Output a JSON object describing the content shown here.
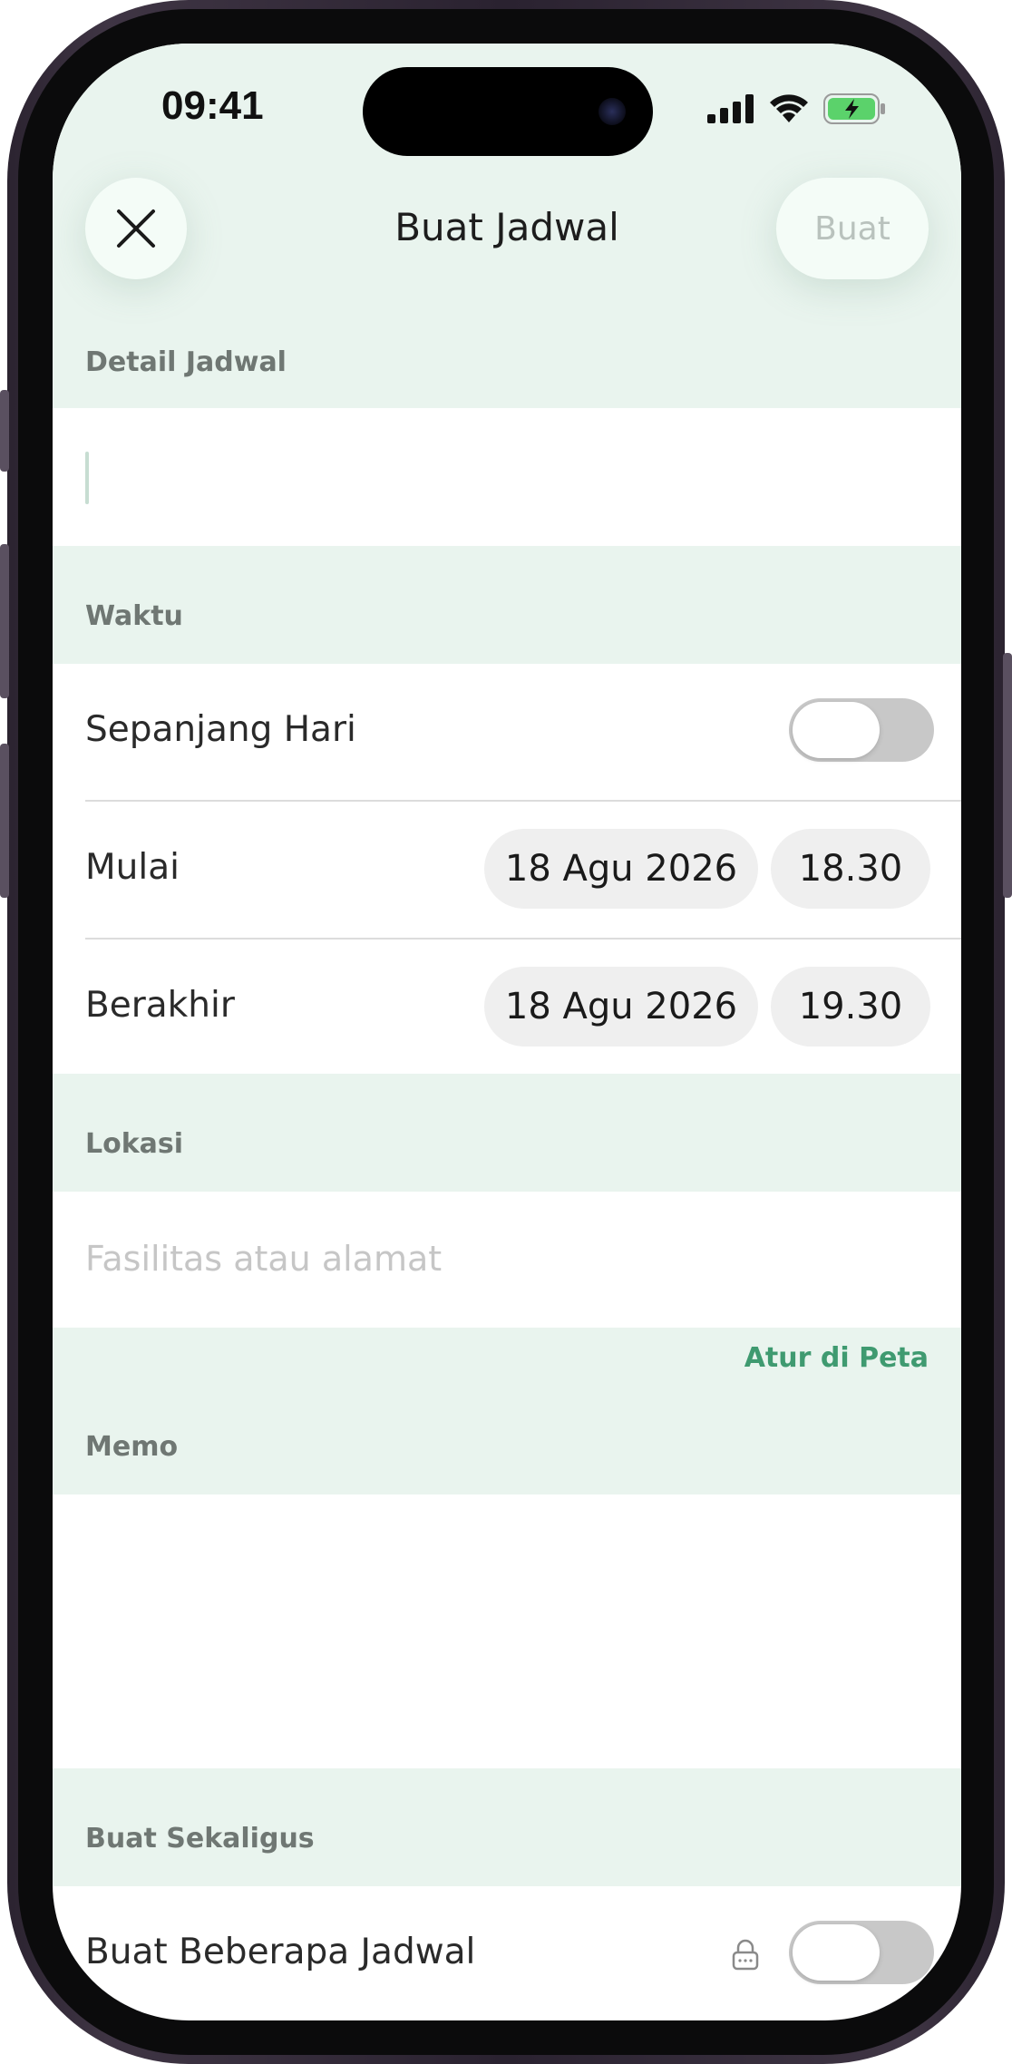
{
  "status_bar": {
    "time": "09:41",
    "icons": [
      "signal-icon",
      "wifi-icon",
      "battery-charging-icon"
    ]
  },
  "header": {
    "title": "Buat Jadwal",
    "close_icon": "close-icon",
    "create_label": "Buat"
  },
  "sections": {
    "detail": {
      "label": "Detail Jadwal",
      "input_value": ""
    },
    "time": {
      "label": "Waktu",
      "all_day_label": "Sepanjang Hari",
      "all_day_on": false,
      "start_label": "Mulai",
      "start_date": "18 Agu 2026",
      "start_time": "18.30",
      "end_label": "Berakhir",
      "end_date": "18 Agu 2026",
      "end_time": "19.30"
    },
    "location": {
      "label": "Lokasi",
      "placeholder": "Fasilitas atau alamat",
      "map_link": "Atur di Peta"
    },
    "memo": {
      "label": "Memo",
      "value": ""
    },
    "bulk": {
      "label": "Buat Sekaligus",
      "multiple_label": "Buat Beberapa Jadwal",
      "multiple_on": false,
      "lock_icon": "lock-icon"
    }
  },
  "colors": {
    "mint_bg": "#e9f4ee",
    "accent_green": "#3f9a70",
    "toggle_off": "#c8c8c8"
  }
}
